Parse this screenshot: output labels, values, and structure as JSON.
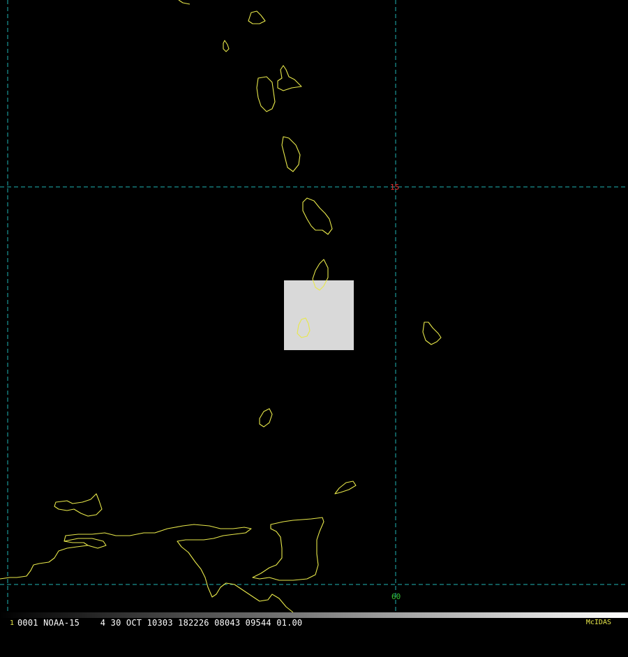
{
  "map": {
    "grid_labels": {
      "latitude": "15",
      "longitude": "60"
    },
    "inset_box": {
      "color": "#d9d9d9"
    },
    "colors": {
      "background": "#000000",
      "grid": "#1fb3b3",
      "coastline": "#e8e84a",
      "latitude_label": "#e03030",
      "longitude_label": "#35c435"
    }
  },
  "status_bar": {
    "frame_number": "1",
    "frame_text": "0001 NOAA-15    4 30 OCT 10303 182226 08043 09544 01.00",
    "brand": "McIDAS",
    "colors": {
      "frame_number": "#e8e84a",
      "frame_text": "#ffffff",
      "brand": "#e8e84a",
      "gradient_start": "#000000",
      "gradient_end": "#ffffff"
    }
  }
}
